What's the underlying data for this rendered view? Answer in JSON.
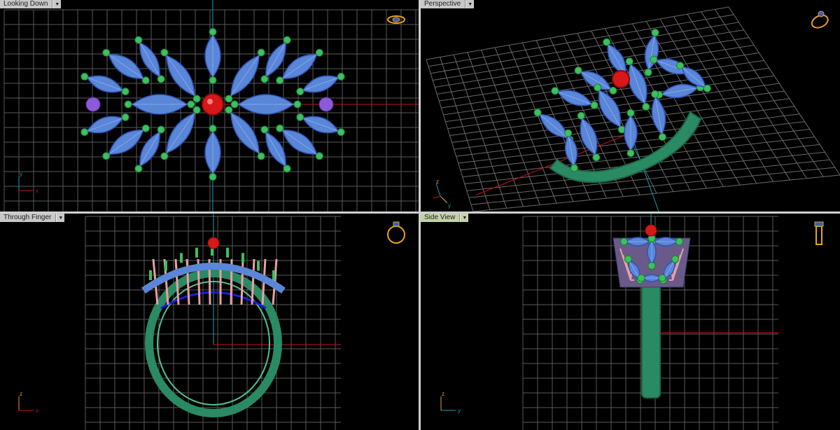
{
  "viewports": {
    "top_left": {
      "label": "Looking Down",
      "axis_vertical": "y",
      "axis_horizontal": "x"
    },
    "top_right": {
      "label": "Perspective",
      "axis_vertical": "z",
      "axis_horizontal": "y"
    },
    "bottom_left": {
      "label": "Through Finger",
      "axis_vertical": "z",
      "axis_horizontal": "x"
    },
    "bottom_right": {
      "label": "Side View",
      "axis_vertical": "z",
      "axis_horizontal": "y"
    }
  },
  "colors": {
    "grid": "#5a5a5a",
    "axis_x": "#c81414",
    "axis_y": "#1aa0b0",
    "stone_blue": "#5a86d8",
    "center_stone": "#d81818",
    "prong_green": "#3cc060",
    "band_green": "#2a8a64",
    "gallery_pink": "#e8a0a0",
    "gallery_blue": "#1a20e0",
    "nav_icon": "#e8a020"
  },
  "nav_icons": [
    "ring-top-view-icon",
    "ring-perspective-icon",
    "ring-front-view-icon",
    "ring-side-view-icon"
  ]
}
